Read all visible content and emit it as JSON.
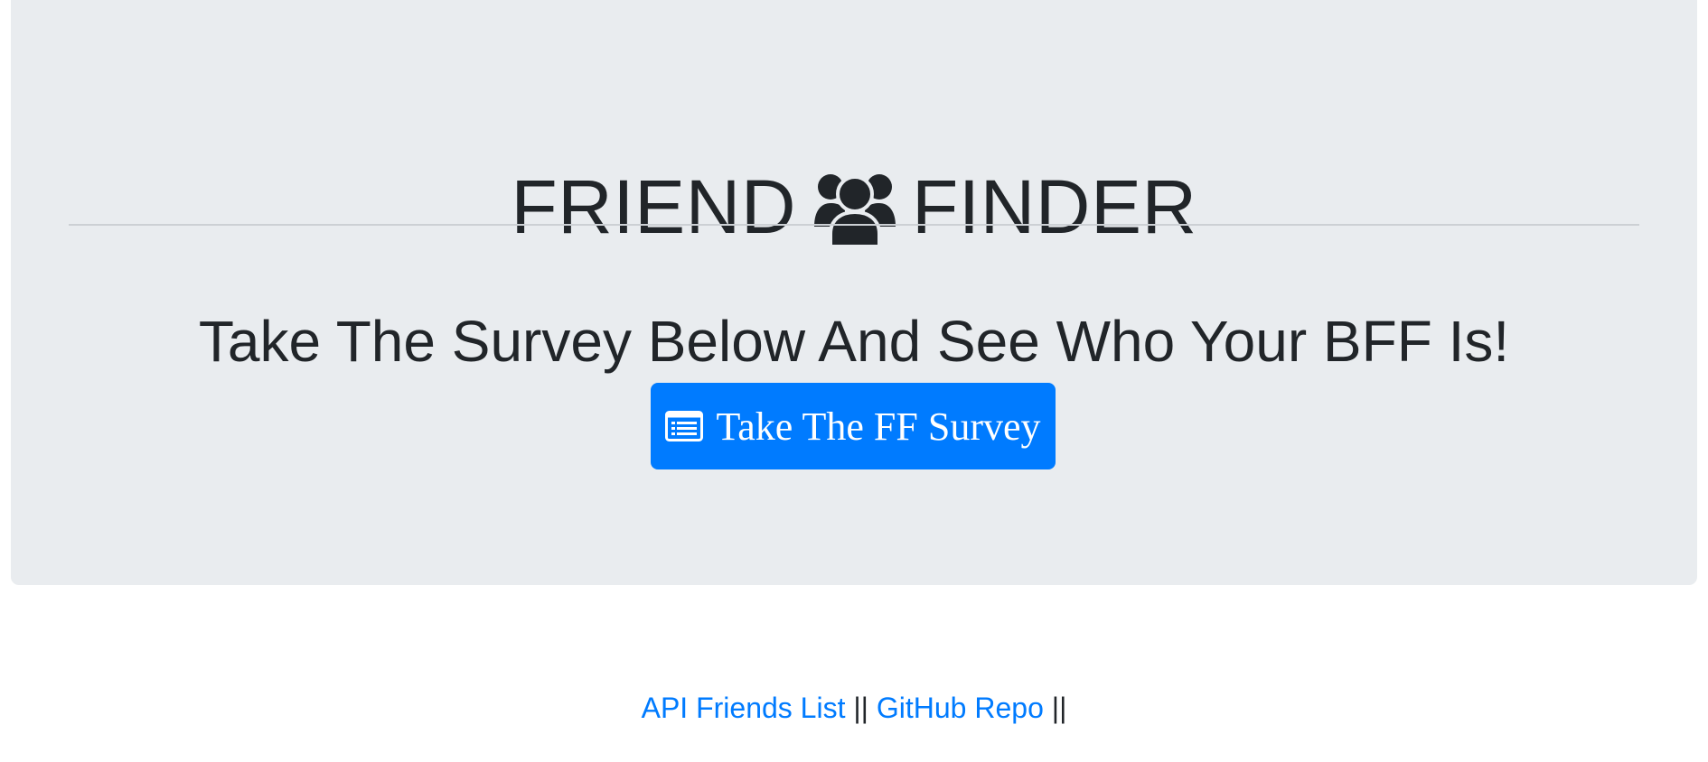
{
  "header": {
    "title_left": "FRIEND",
    "title_icon": "users-icon",
    "title_right": "FINDER",
    "subtitle": "Take The Survey Below And See Who Your BFF Is!"
  },
  "survey_button": {
    "icon": "list-alt-icon",
    "label": "Take The FF Survey"
  },
  "footer": {
    "links": [
      {
        "label": "API Friends List"
      },
      {
        "label": "GitHub Repo"
      }
    ],
    "separator": "||"
  },
  "colors": {
    "jumbotron_bg": "#e9ecef",
    "primary": "#007bff",
    "text": "#212529"
  }
}
